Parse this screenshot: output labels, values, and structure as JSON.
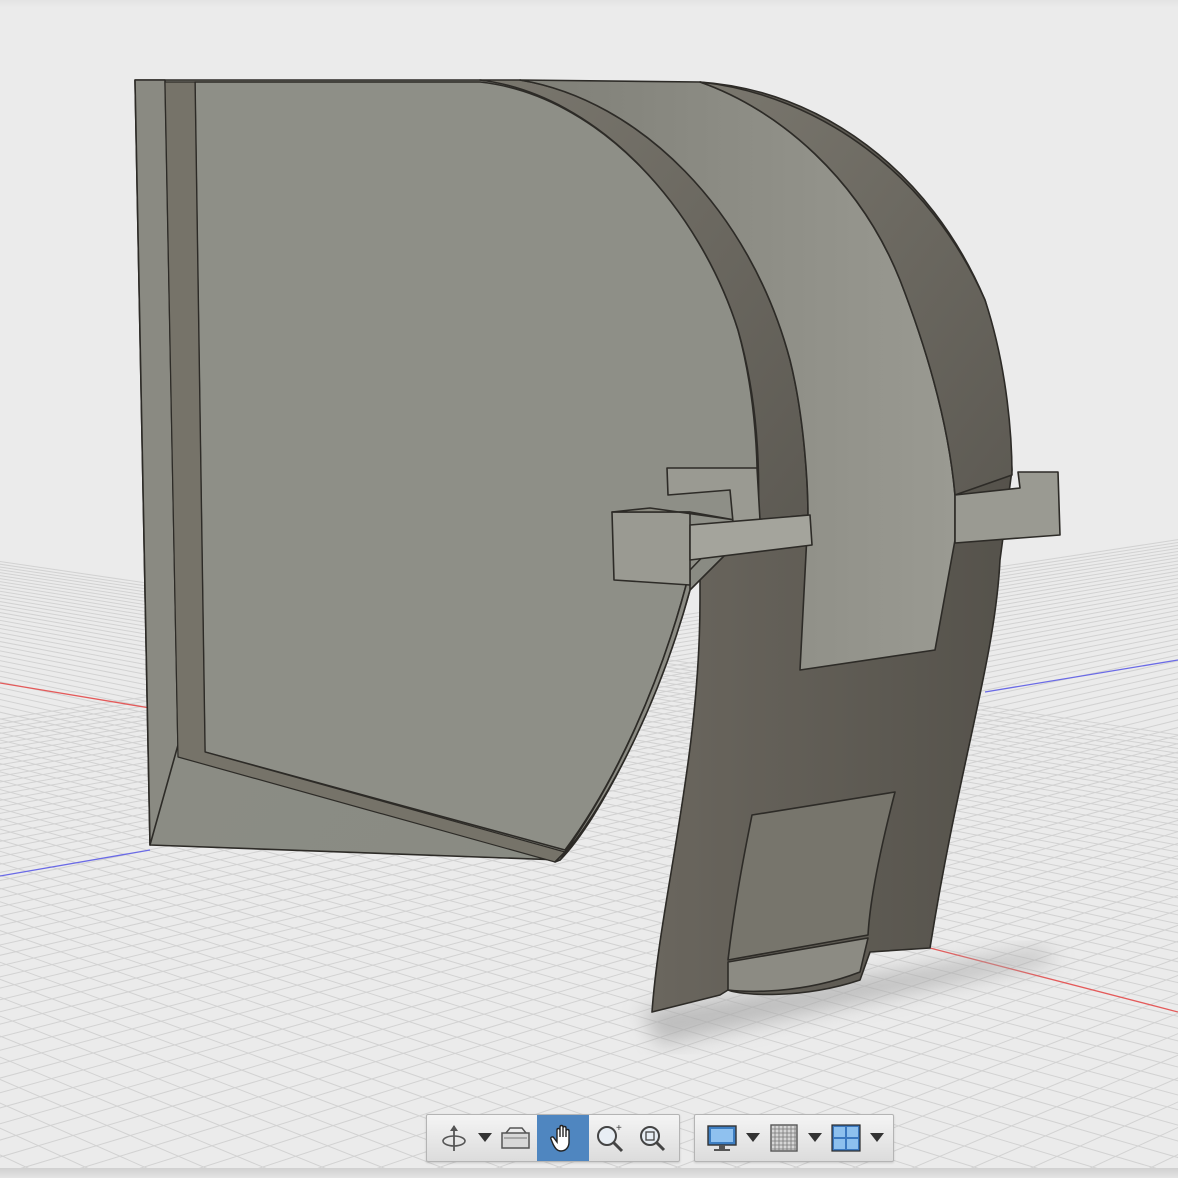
{
  "app": {
    "view": "3d-model-viewport"
  },
  "colors": {
    "background": "#ebebeb",
    "grid_line": "#d2d2d2",
    "axis_x": "#e04b4b",
    "axis_z": "#5a5ae0",
    "model_face_light": "#8c8c84",
    "model_face_dark": "#5e5b54",
    "toolbar_active": "#4f86c0"
  },
  "toolbar": {
    "nav_group": [
      {
        "name": "orbit",
        "icon": "orbit-icon",
        "has_dropdown": true
      },
      {
        "name": "look-at",
        "icon": "look-at-icon"
      },
      {
        "name": "pan",
        "icon": "pan-hand-icon",
        "active": true
      },
      {
        "name": "zoom",
        "icon": "zoom-icon"
      },
      {
        "name": "fit",
        "icon": "fit-icon"
      }
    ],
    "display_group": [
      {
        "name": "display-settings",
        "icon": "display-settings-icon",
        "has_dropdown": true
      },
      {
        "name": "grid-and-snaps",
        "icon": "grid-icon",
        "has_dropdown": true
      },
      {
        "name": "viewports",
        "icon": "viewports-icon",
        "has_dropdown": true
      }
    ]
  }
}
